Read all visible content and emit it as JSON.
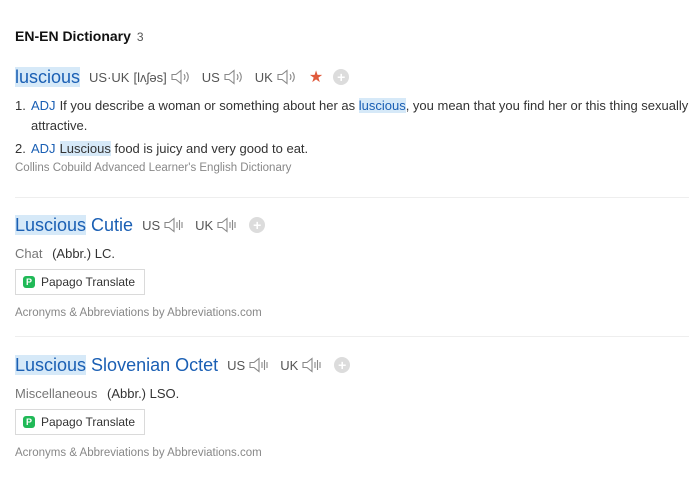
{
  "section": {
    "title": "EN-EN Dictionary",
    "count": "3"
  },
  "entries": [
    {
      "headword": "luscious",
      "pronunciations": [
        {
          "label": "US·UK",
          "ipa": "[lʌʃəs]",
          "icon": "speaker-icon"
        },
        {
          "label": "US",
          "icon": "speaker-icon"
        },
        {
          "label": "UK",
          "icon": "speaker-icon"
        }
      ],
      "starred": true,
      "definitions": [
        {
          "num": "1.",
          "pos": "ADJ",
          "before": "If you describe a woman or something about her as ",
          "highlight": "luscious",
          "after": ", you mean that you find her or this thing sexually attractive."
        },
        {
          "num": "2.",
          "pos": "ADJ",
          "before": "",
          "highlight": "Luscious",
          "after": " food is juicy and very good to eat."
        }
      ],
      "source": "Collins Cobuild Advanced Learner's English Dictionary"
    },
    {
      "headword_highlight": "Luscious",
      "headword_rest": " Cutie",
      "pronunciations": [
        {
          "label": "US",
          "icon": "speaker-icon"
        },
        {
          "label": "UK",
          "icon": "speaker-icon"
        }
      ],
      "category": "Chat",
      "abbr": "(Abbr.) LC.",
      "translate_label": "Papago Translate",
      "source": "Acronyms & Abbreviations by Abbreviations.com"
    },
    {
      "headword_highlight": "Luscious",
      "headword_rest": " Slovenian Octet",
      "pronunciations": [
        {
          "label": "US",
          "icon": "speaker-icon"
        },
        {
          "label": "UK",
          "icon": "speaker-icon"
        }
      ],
      "category": "Miscellaneous",
      "abbr": "(Abbr.) LSO.",
      "translate_label": "Papago Translate",
      "source": "Acronyms & Abbreviations by Abbreviations.com"
    }
  ],
  "colors": {
    "link": "#1a5fb4",
    "highlight": "#d6e9f8",
    "star": "#e05a3c",
    "papago": "#20b957"
  }
}
